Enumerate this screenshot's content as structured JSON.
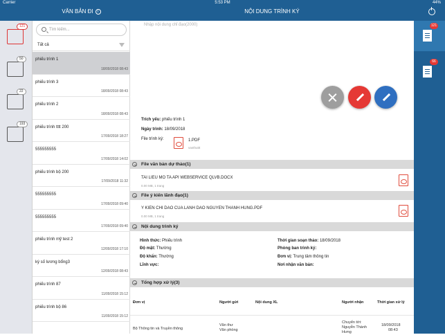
{
  "status_bar": {
    "carrier": "Carrier",
    "time": "5:53 PM",
    "battery": "44%"
  },
  "nav": {
    "left_title": "VĂN BẢN ĐI",
    "center_title": "NỘI DUNG TRÌNH KÝ",
    "info_glyph": "i"
  },
  "left_rail": {
    "badges": [
      "121",
      "50",
      "22",
      "193"
    ],
    "icons": [
      "sign-document-icon",
      "approve-document-icon",
      "reject-document-icon",
      "archive-tray-icon"
    ]
  },
  "search": {
    "placeholder": "Tìm kiếm..."
  },
  "filter": {
    "label": "Tất cả"
  },
  "list": [
    {
      "title": "phiếu trình 1",
      "date": "18/09/2018 08:43"
    },
    {
      "title": "phiếu trình 3",
      "date": "18/09/2018 08:43"
    },
    {
      "title": "phiếu trình 2",
      "date": "18/09/2018 08:43"
    },
    {
      "title": "phiếu trình tttt 200",
      "date": "17/09/2018 18:27"
    },
    {
      "title": "555555555",
      "date": "17/09/2018 14:02"
    },
    {
      "title": "phiếu trình bộ 200",
      "date": "17/09/2018 11:32"
    },
    {
      "title": "555555555",
      "date": "17/09/2018 09:40"
    },
    {
      "title": "555555555",
      "date": "17/09/2018 09:40"
    },
    {
      "title": "phiếu trình mỹ test 2",
      "date": "12/09/2018 17:10"
    },
    {
      "title": "ký số lương bổng3",
      "date": "12/09/2018 08:43"
    },
    {
      "title": "phiếu trình 87",
      "date": "11/09/2018 15:12"
    },
    {
      "title": "phiếu trình bộ 86",
      "date": "11/09/2018 15:12"
    }
  ],
  "right_rail": {
    "badge_1": "121",
    "badge_2": "66"
  },
  "content": {
    "textarea_placeholder": "Nhập nội dung chỉ đạo(2000)",
    "trich_yeu_label": "Trích yếu:",
    "trich_yeu": "phiếu trình 1",
    "ngay_trinh_label": "Ngày trình:",
    "ngay_trinh": "18/09/2018",
    "file_trinh_ky_label": "File trình ký:",
    "file_name": "1.PDF",
    "file_sub": "vanthuttt"
  },
  "sections": {
    "du_thao": "File văn bản dự thảo(1)",
    "y_kien": "File ý kiến lãnh đạo(1)",
    "noi_dung": "Nội dung trình ký",
    "tong_hop": "Tổng hợp xử lý(3)"
  },
  "files": {
    "du_thao_name": "TAI LIEU MO TA API WEBSERVICE QLVB.DOCX",
    "du_thao_meta": "0.00 MB, 1 trang",
    "y_kien_name": "Y KIEN CHI DAO CUA LANH DAO NGUYEN THANH HUNG.PDF",
    "y_kien_meta": "0.00 MB, 1 trang"
  },
  "details": {
    "hinh_thuc_label": "Hình thức:",
    "hinh_thuc": "Phiếu trình",
    "do_mat_label": "Độ mật:",
    "do_mat": "Thường",
    "do_khan_label": "Độ khẩn:",
    "do_khan": "Thường",
    "linh_vuc_label": "Lĩnh vực:",
    "thoi_gian_label": "Thời gian soạn thảo:",
    "thoi_gian": "18/09/2018",
    "phong_ban_label": "Phòng ban trình ký:",
    "don_vi_label": "Đơn vị:",
    "don_vi": "Trung tâm thông tin",
    "noi_nhan_label": "Nơi nhận văn bản:"
  },
  "table": {
    "headers": [
      "Đơn vị",
      "Người gửi",
      "Nội dung XL",
      "Người nhận",
      "Thời gian xử lý"
    ],
    "row": {
      "don_vi": "Bộ Thông tin và Truyền thông",
      "nguoi_gui_1": "Văn thư",
      "nguoi_gui_2": "Văn phòng",
      "nguoi_nhan_1": "Chuyển tới:",
      "nguoi_nhan_2": "Nguyễn Thành",
      "nguoi_nhan_3": "Hưng",
      "thoi_gian_1": "18/09/2018",
      "thoi_gian_2": "08:43"
    }
  },
  "colors": {
    "primary": "#1f5f93",
    "accent_red": "#e53935",
    "accent_blue": "#2f6fc0",
    "fab_grey": "#9e9e9e"
  }
}
